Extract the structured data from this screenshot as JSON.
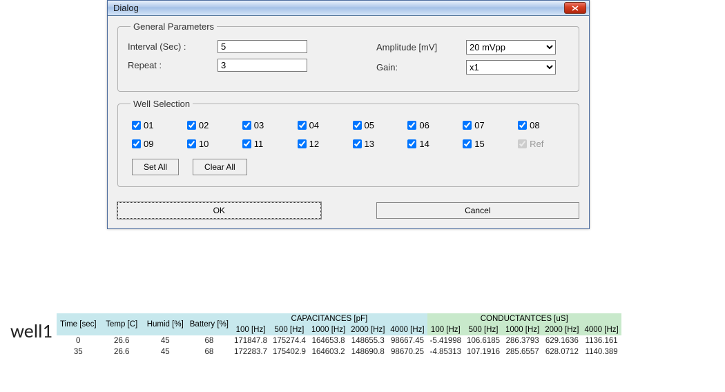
{
  "dialog": {
    "title": "Dialog",
    "general": {
      "legend": "General Parameters",
      "interval_label": "Interval (Sec) :",
      "interval_value": "5",
      "repeat_label": "Repeat :",
      "repeat_value": "3",
      "amplitude_label": "Amplitude [mV]",
      "amplitude_value": "20  mVpp",
      "gain_label": "Gain:",
      "gain_value": "x1"
    },
    "wells": {
      "legend": "Well Selection",
      "items": [
        {
          "label": "01",
          "checked": true
        },
        {
          "label": "02",
          "checked": true
        },
        {
          "label": "03",
          "checked": true
        },
        {
          "label": "04",
          "checked": true
        },
        {
          "label": "05",
          "checked": true
        },
        {
          "label": "06",
          "checked": true
        },
        {
          "label": "07",
          "checked": true
        },
        {
          "label": "08",
          "checked": true
        },
        {
          "label": "09",
          "checked": true
        },
        {
          "label": "10",
          "checked": true
        },
        {
          "label": "11",
          "checked": true
        },
        {
          "label": "12",
          "checked": true
        },
        {
          "label": "13",
          "checked": true
        },
        {
          "label": "14",
          "checked": true
        },
        {
          "label": "15",
          "checked": true
        },
        {
          "label": "Ref",
          "checked": true,
          "disabled": true
        }
      ],
      "set_all": "Set All",
      "clear_all": "Clear All"
    },
    "ok": "OK",
    "cancel": "Cancel"
  },
  "table": {
    "well_label": "well1",
    "headers": {
      "time": "Time [sec]",
      "temp": "Temp [C]",
      "humid": "Humid [%]",
      "battery": "Battery [%]",
      "cap_group": "CAPACITANCES  [pF]",
      "cond_group": "CONDUCTANTCES  [uS]",
      "freqs": [
        "100 [Hz]",
        "500 [Hz]",
        "1000 [Hz]",
        "2000 [Hz]",
        "4000 [Hz]"
      ]
    },
    "rows": [
      {
        "time": "0",
        "temp": "26.6",
        "humid": "45",
        "battery": "68",
        "cap": [
          "171847.8",
          "175274.4",
          "164653.8",
          "148655.3",
          "98667.45"
        ],
        "cond": [
          "-5.41998",
          "106.6185",
          "286.3793",
          "629.1636",
          "1136.161"
        ]
      },
      {
        "time": "35",
        "temp": "26.6",
        "humid": "45",
        "battery": "68",
        "cap": [
          "172283.7",
          "175402.9",
          "164603.2",
          "148690.8",
          "98670.25"
        ],
        "cond": [
          "-4.85313",
          "107.1916",
          "285.6557",
          "628.0712",
          "1140.389"
        ]
      }
    ]
  }
}
